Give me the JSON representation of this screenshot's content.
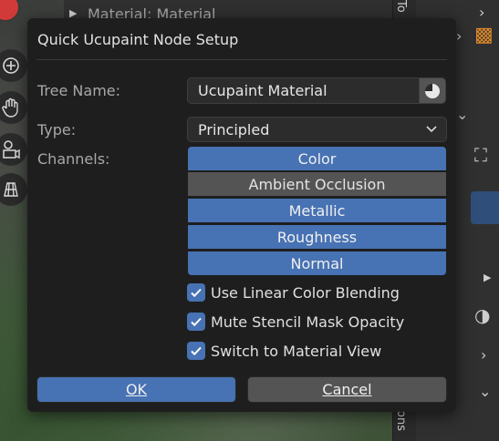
{
  "background": {
    "outliner_row_label": "Material: Material",
    "vertical_tab_top": "To",
    "vertical_tab_bottom": "ons"
  },
  "dialog": {
    "title": "Quick Ucupaint Node Setup",
    "tree_name_label": "Tree Name:",
    "tree_name_value": "Ucupaint Material",
    "type_label": "Type:",
    "type_value": "Principled",
    "channels_label": "Channels:",
    "channels": [
      {
        "label": "Color",
        "enabled": true
      },
      {
        "label": "Ambient Occlusion",
        "enabled": false
      },
      {
        "label": "Metallic",
        "enabled": true
      },
      {
        "label": "Roughness",
        "enabled": true
      },
      {
        "label": "Normal",
        "enabled": true
      }
    ],
    "options": [
      {
        "label": "Use Linear Color Blending",
        "checked": true
      },
      {
        "label": "Mute Stencil Mask Opacity",
        "checked": true
      },
      {
        "label": "Switch to Material View",
        "checked": true
      }
    ],
    "ok_label": "OK",
    "cancel_label": "Cancel"
  },
  "colors": {
    "accent": "#4772b3",
    "dialog_bg": "#1e1e1e",
    "toggle_off": "#545454"
  }
}
